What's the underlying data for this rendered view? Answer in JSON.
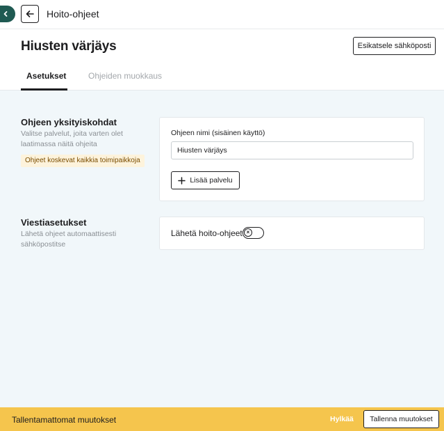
{
  "topbar": {
    "title": "Hoito-ohjeet",
    "collapse_icon": "chevron-left-icon",
    "back_icon": "arrow-left-icon"
  },
  "header": {
    "title": "Hiusten värjäys",
    "preview_button": "Esikatsele sähköposti",
    "tabs": [
      {
        "label": "Asetukset",
        "active": true
      },
      {
        "label": "Ohjeiden muokkaus",
        "active": false
      }
    ]
  },
  "details_section": {
    "title": "Ohjeen yksityiskohdat",
    "description": "Valitse palvelut, joita varten olet laatimassa näitä ohjeita",
    "badge": "Ohjeet koskevat kaikkia toimipaikkoja",
    "name_label": "Ohjeen nimi (sisäinen käyttö)",
    "name_value": "Hiusten värjäys",
    "add_service_button": "Lisää palvelu",
    "add_icon": "plus-icon"
  },
  "message_section": {
    "title": "Viestiasetukset",
    "description": "Lähetä ohjeet automaattisesti sähköpostitse",
    "toggle_label": "Lähetä hoito-ohjeet",
    "toggle_on": false,
    "toggle_symbol": "×"
  },
  "footer": {
    "text": "Tallentamattomat muutokset",
    "discard": "Hylkää",
    "save_button": "Tallenna muutokset"
  },
  "colors": {
    "accent": "#1f5a52",
    "background": "#f1f7fa",
    "footer": "#f5c54d",
    "badge_bg": "#fdf3dc",
    "badge_text": "#7a4d00",
    "inactive_tab": "#a4a8ac"
  }
}
